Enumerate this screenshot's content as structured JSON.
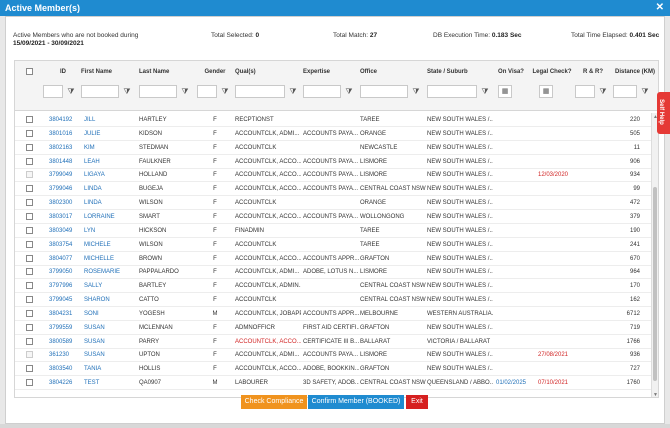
{
  "window": {
    "title": "Active Member(s)"
  },
  "summary": {
    "description_line1": "Active Members who are not booked during",
    "date_range": "15/09/2021 - 30/09/2021",
    "total_selected_label": "Total Selected:",
    "total_selected_value": "0",
    "total_match_label": "Total Match:",
    "total_match_value": "27",
    "db_exec_label": "DB Execution Time:",
    "db_exec_value": "0.183 Sec",
    "total_elapsed_label": "Total Time Elapsed:",
    "total_elapsed_value": "0.401 Sec"
  },
  "columns": [
    "ID",
    "First Name",
    "Last Name",
    "Gender",
    "Qual(s)",
    "Expertise",
    "Office",
    "State / Suburb",
    "On Visa?",
    "Legal Check?",
    "R & R?",
    "Distance (KM)"
  ],
  "rows": [
    {
      "id": "3804192",
      "first": "JILL",
      "last": "HARTLEY",
      "gender": "F",
      "qual": "RECPTIONST",
      "expertise": "",
      "office": "TAREE",
      "state": "NEW SOUTH WALES /...",
      "visa": "",
      "legal": "",
      "rr": "",
      "dist": "220",
      "qual_red": false,
      "check_disabled": false
    },
    {
      "id": "3801016",
      "first": "JULIE",
      "last": "KIDSON",
      "gender": "F",
      "qual": "ACCOUNTCLK, ADMI...",
      "expertise": "ACCOUNTS PAYA...",
      "office": "ORANGE",
      "state": "NEW SOUTH WALES /...",
      "visa": "",
      "legal": "",
      "rr": "",
      "dist": "505",
      "qual_red": false,
      "check_disabled": false
    },
    {
      "id": "3802163",
      "first": "KIM",
      "last": "STEDMAN",
      "gender": "F",
      "qual": "ACCOUNTCLK",
      "expertise": "",
      "office": "NEWCASTLE",
      "state": "NEW SOUTH WALES /...",
      "visa": "",
      "legal": "",
      "rr": "",
      "dist": "11",
      "qual_red": false,
      "check_disabled": false
    },
    {
      "id": "3801448",
      "first": "LEAH",
      "last": "FAULKNER",
      "gender": "F",
      "qual": "ACCOUNTCLK, ACCO...",
      "expertise": "ACCOUNTS PAYA...",
      "office": "LISMORE",
      "state": "NEW SOUTH WALES /...",
      "visa": "",
      "legal": "",
      "rr": "",
      "dist": "906",
      "qual_red": false,
      "check_disabled": false
    },
    {
      "id": "3799049",
      "first": "LIGAYA",
      "last": "HOLLAND",
      "gender": "F",
      "qual": "ACCOUNTCLK, ACCO...",
      "expertise": "ACCOUNTS PAYA...",
      "office": "LISMORE",
      "state": "NEW SOUTH WALES /...",
      "visa": "",
      "legal": "12/03/2020",
      "rr": "",
      "dist": "934",
      "qual_red": false,
      "check_disabled": true
    },
    {
      "id": "3799046",
      "first": "LINDA",
      "last": "BUGEJA",
      "gender": "F",
      "qual": "ACCOUNTCLK, ACCO...",
      "expertise": "ACCOUNTS PAYA...",
      "office": "CENTRAL COAST NSW",
      "state": "NEW SOUTH WALES /...",
      "visa": "",
      "legal": "",
      "rr": "",
      "dist": "99",
      "qual_red": false,
      "check_disabled": false
    },
    {
      "id": "3802300",
      "first": "LINDA",
      "last": "WILSON",
      "gender": "F",
      "qual": "ACCOUNTCLK",
      "expertise": "",
      "office": "ORANGE",
      "state": "NEW SOUTH WALES /...",
      "visa": "",
      "legal": "",
      "rr": "",
      "dist": "472",
      "qual_red": false,
      "check_disabled": false
    },
    {
      "id": "3803017",
      "first": "LORRAINE",
      "last": "SMART",
      "gender": "F",
      "qual": "ACCOUNTCLK, ACCO...",
      "expertise": "ACCOUNTS PAYA...",
      "office": "WOLLONGONG",
      "state": "NEW SOUTH WALES /...",
      "visa": "",
      "legal": "",
      "rr": "",
      "dist": "379",
      "qual_red": false,
      "check_disabled": false
    },
    {
      "id": "3803049",
      "first": "LYN",
      "last": "HICKSON",
      "gender": "F",
      "qual": "FINADMIN",
      "expertise": "",
      "office": "TAREE",
      "state": "NEW SOUTH WALES /...",
      "visa": "",
      "legal": "",
      "rr": "",
      "dist": "190",
      "qual_red": false,
      "check_disabled": false
    },
    {
      "id": "3803754",
      "first": "MICHELE",
      "last": "WILSON",
      "gender": "F",
      "qual": "ACCOUNTCLK",
      "expertise": "",
      "office": "TAREE",
      "state": "NEW SOUTH WALES /...",
      "visa": "",
      "legal": "",
      "rr": "",
      "dist": "241",
      "qual_red": false,
      "check_disabled": false
    },
    {
      "id": "3804077",
      "first": "MICHELLE",
      "last": "BROWN",
      "gender": "F",
      "qual": "ACCOUNTCLK, ACCO...",
      "expertise": "ACCOUNTS APPR...",
      "office": "GRAFTON",
      "state": "NEW SOUTH WALES /...",
      "visa": "",
      "legal": "",
      "rr": "",
      "dist": "670",
      "qual_red": false,
      "check_disabled": false
    },
    {
      "id": "3799050",
      "first": "ROSEMARIE",
      "last": "PAPPALARDO",
      "gender": "F",
      "qual": "ACCOUNTCLK, ADMI...",
      "expertise": "ADOBE, LOTUS N...",
      "office": "LISMORE",
      "state": "NEW SOUTH WALES /...",
      "visa": "",
      "legal": "",
      "rr": "",
      "dist": "964",
      "qual_red": false,
      "check_disabled": false
    },
    {
      "id": "3797996",
      "first": "SALLY",
      "last": "BARTLEY",
      "gender": "F",
      "qual": "ACCOUNTCLK, ADMIN...",
      "expertise": "",
      "office": "CENTRAL COAST NSW",
      "state": "NEW SOUTH WALES /...",
      "visa": "",
      "legal": "",
      "rr": "",
      "dist": "170",
      "qual_red": false,
      "check_disabled": false
    },
    {
      "id": "3799045",
      "first": "SHARON",
      "last": "CATTO",
      "gender": "F",
      "qual": "ACCOUNTCLK",
      "expertise": "",
      "office": "CENTRAL COAST NSW",
      "state": "NEW SOUTH WALES /...",
      "visa": "",
      "legal": "",
      "rr": "",
      "dist": "162",
      "qual_red": false,
      "check_disabled": false
    },
    {
      "id": "3804231",
      "first": "SONI",
      "last": "YOGESH",
      "gender": "M",
      "qual": "ACCOUNTCLK, JOBAPP",
      "expertise": "ACCOUNTS APPR...",
      "office": "MELBOURNE",
      "state": "WESTERN AUSTRALIA...",
      "visa": "",
      "legal": "",
      "rr": "",
      "dist": "6712",
      "qual_red": false,
      "check_disabled": false
    },
    {
      "id": "3799559",
      "first": "SUSAN",
      "last": "MCLENNAN",
      "gender": "F",
      "qual": "ADMNOFFICR",
      "expertise": "FIRST AID CERTIFI...",
      "office": "GRAFTON",
      "state": "NEW SOUTH WALES /...",
      "visa": "",
      "legal": "",
      "rr": "",
      "dist": "719",
      "qual_red": false,
      "check_disabled": false
    },
    {
      "id": "3800589",
      "first": "SUSAN",
      "last": "PARRY",
      "gender": "F",
      "qual": "ACCOUNTCLK, ACCO...",
      "expertise": "CERTIFICATE III B...",
      "office": "BALLARAT",
      "state": "VICTORIA / BALLARAT",
      "visa": "",
      "legal": "",
      "rr": "",
      "dist": "1766",
      "qual_red": true,
      "check_disabled": false
    },
    {
      "id": "361230",
      "first": "SUSAN",
      "last": "UPTON",
      "gender": "F",
      "qual": "ACCOUNTCLK, ADMI...",
      "expertise": "ACCOUNTS PAYA...",
      "office": "LISMORE",
      "state": "NEW SOUTH WALES /...",
      "visa": "",
      "legal": "27/08/2021",
      "rr": "",
      "dist": "936",
      "qual_red": false,
      "check_disabled": true
    },
    {
      "id": "3803540",
      "first": "TANIA",
      "last": "HOLLIS",
      "gender": "F",
      "qual": "ACCOUNTCLK, ACCO...",
      "expertise": "ADOBE, BOOKKIN...",
      "office": "GRAFTON",
      "state": "NEW SOUTH WALES /...",
      "visa": "",
      "legal": "",
      "rr": "",
      "dist": "727",
      "qual_red": false,
      "check_disabled": false
    },
    {
      "id": "3804226",
      "first": "TEST",
      "last": "QA0907",
      "gender": "M",
      "qual": "LABOURER",
      "expertise": "3D SAFETY, ADOB...",
      "office": "CENTRAL COAST NSW",
      "state": "QUEENSLAND / ABBO...",
      "visa": "01/02/2025",
      "legal": "07/10/2021",
      "rr": "",
      "dist": "1760",
      "qual_red": false,
      "check_disabled": false
    }
  ],
  "buttons": {
    "check_compliance": "Check Compliance",
    "confirm_member": "Confirm Member (BOOKED)",
    "exit": "Exit"
  },
  "side_tab": {
    "label": "Self Help"
  },
  "colors": {
    "title_bar": "#1f8bd0",
    "link": "#1f6fb8",
    "warn": "#d12424",
    "btn_orange": "#f0931e",
    "btn_blue": "#1f8bd0",
    "btn_red": "#d62020"
  },
  "icons": {
    "close": "close-icon",
    "filter": "filter-icon",
    "calendar": "calendar-icon"
  }
}
